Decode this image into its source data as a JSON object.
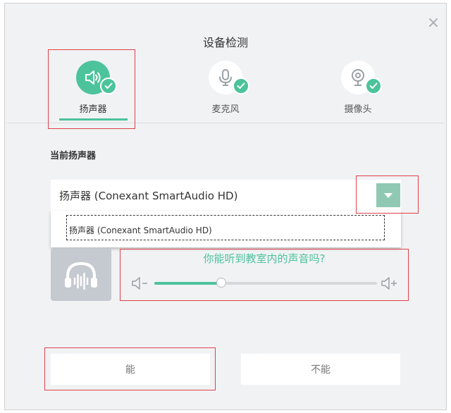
{
  "dialog": {
    "title": "设备检测"
  },
  "tabs": [
    {
      "label": "扬声器",
      "icon": "speaker-icon",
      "active": true,
      "checked": true
    },
    {
      "label": "麦克风",
      "icon": "microphone-icon",
      "active": false,
      "checked": true
    },
    {
      "label": "摄像头",
      "icon": "camera-icon",
      "active": false,
      "checked": true
    }
  ],
  "speaker_section": {
    "label": "当前扬声器",
    "selected": "扬声器 (Conexant SmartAudio HD)",
    "options": [
      "扬声器 (Conexant SmartAudio HD)"
    ]
  },
  "test": {
    "question": "你能听到教室内的声音吗?",
    "volume_fraction": 0.3
  },
  "buttons": {
    "yes": "能",
    "no": "不能"
  },
  "colors": {
    "accent": "#4cc39b",
    "highlight": "#e0404a"
  }
}
